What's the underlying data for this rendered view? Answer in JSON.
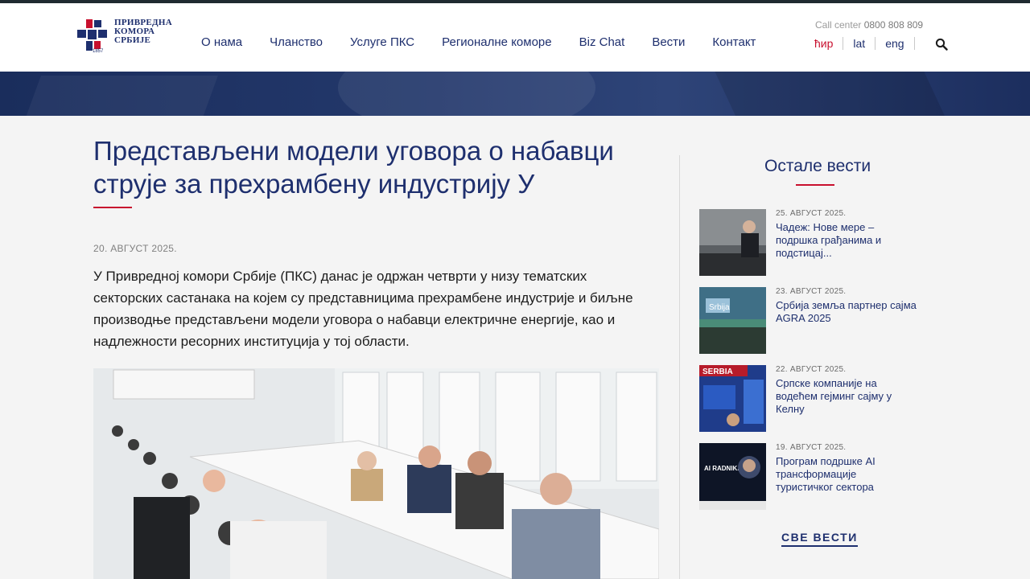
{
  "header": {
    "logo": {
      "line1": "ПРИВРЕДНА",
      "line2": "КОМОРА",
      "line3": "СРБИЈЕ",
      "year": "1857"
    },
    "nav": [
      "О нама",
      "Чланство",
      "Услуге ПКС",
      "Регионалне коморе",
      "Biz Chat",
      "Вести",
      "Контакт"
    ],
    "callcenter_label": "Call center",
    "callcenter_number": "0800 808 809",
    "languages": [
      "ћир",
      "lat",
      "eng"
    ],
    "active_language": "ћир",
    "search_icon": "search-icon"
  },
  "article": {
    "title": "Представљени модели уговора о набавци струје за прехрамбену индустрију У",
    "date": "20. АВГУСТ 2025.",
    "lead": "У Привредној комори Србије (ПКС) данас је одржан четврти у низу тематских секторских састанака на којем су представницима прехрамбене индустрије и биљне производње представљени модели уговора о набавци електричне енергије, као и надлежности ресорних институција у тој области."
  },
  "sidebar": {
    "title": "Остале вести",
    "items": [
      {
        "date": "25. АВГУСТ 2025.",
        "title": "Чадеж: Нове мере – подршка грађанима и подстицај..."
      },
      {
        "date": "23. АВГУСТ 2025.",
        "title": "Србија земља партнер сајма AGRA 2025",
        "thumb_text": "Srbija"
      },
      {
        "date": "22. АВГУСТ 2025.",
        "title": "Српске компаније на водећем гејминг сајму у Келну",
        "thumb_text": "SERBIA"
      },
      {
        "date": "19. АВГУСТ 2025.",
        "title": "Програм подршке АI трансформације туристичког сектора",
        "thumb_text": "AI RADNIKA"
      }
    ],
    "all_news": "СВЕ ВЕСТИ"
  },
  "colors": {
    "brand_blue": "#1e2f6e",
    "accent_red": "#c8102e"
  }
}
